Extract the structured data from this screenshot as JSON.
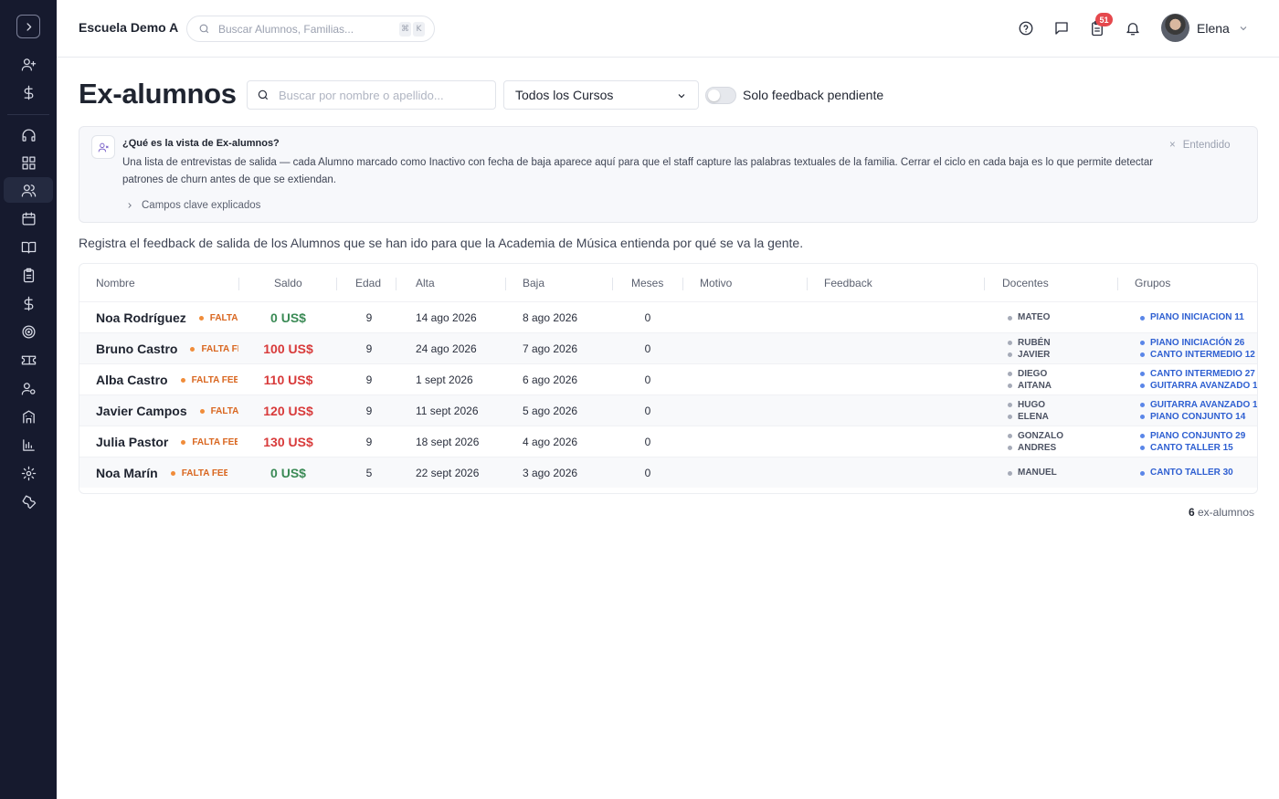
{
  "app": {
    "school_name": "Escuela Demo A",
    "global_search_placeholder": "Buscar Alumnos, Familias...",
    "shortcut_keys": [
      "⌘",
      "K"
    ],
    "notification_count": "51",
    "user_name": "Elena"
  },
  "sidebar": {
    "items": [
      {
        "icon": "user-plus-icon"
      },
      {
        "icon": "dollar-icon"
      },
      {
        "icon": "headset-icon"
      },
      {
        "icon": "dashboard-icon"
      },
      {
        "icon": "users-icon",
        "active": true
      },
      {
        "icon": "calendar-icon"
      },
      {
        "icon": "book-icon"
      },
      {
        "icon": "clipboard-icon"
      },
      {
        "icon": "dollar-icon"
      },
      {
        "icon": "target-icon"
      },
      {
        "icon": "ticket-icon"
      },
      {
        "icon": "user-settings-icon"
      },
      {
        "icon": "building-icon"
      },
      {
        "icon": "chart-icon"
      },
      {
        "icon": "gear-icon"
      },
      {
        "icon": "wrench-icon"
      }
    ]
  },
  "page": {
    "title": "Ex-alumnos",
    "search_placeholder": "Buscar por nombre o apellido...",
    "course_filter": "Todos los Cursos",
    "toggle_label": "Solo feedback pendiente",
    "toggle_on": false
  },
  "info": {
    "title": "¿Qué es la vista de Ex-alumnos?",
    "text": "Una lista de entrevistas de salida — cada Alumno marcado como Inactivo con fecha de baja aparece aquí para que el staff capture las palabras textuales de la familia. Cerrar el ciclo en cada baja es lo que permite detectar patrones de churn antes de que se extiendan.",
    "expander": "Campos clave explicados",
    "dismiss": "Entendido"
  },
  "description": "Registra el feedback de salida de los Alumnos que se han ido para que la Academia de Música entienda por qué se va la gente.",
  "table": {
    "columns": [
      "Nombre",
      "Saldo",
      "Edad",
      "Alta",
      "Baja",
      "Meses",
      "Motivo",
      "Feedback",
      "Docentes",
      "Grupos"
    ],
    "rows": [
      {
        "name": "Noa Rodríguez",
        "badge": "FALTA FEEDBACK",
        "saldo": "0 US$",
        "saldo_positive": true,
        "edad": "9",
        "alta": "14 ago 2026",
        "baja": "8 ago 2026",
        "meses": "0",
        "motivo": "",
        "feedback": "",
        "docentes": [
          "MATEO"
        ],
        "grupos": [
          "PIANO INICIACION 11"
        ]
      },
      {
        "name": "Bruno Castro",
        "badge": "FALTA FEEDBACK",
        "saldo": "100 US$",
        "saldo_positive": false,
        "edad": "9",
        "alta": "24 ago 2026",
        "baja": "7 ago 2026",
        "meses": "0",
        "motivo": "",
        "feedback": "",
        "docentes": [
          "RUBÉN",
          "JAVIER"
        ],
        "grupos": [
          "PIANO INICIACIÓN 26",
          "CANTO INTERMEDIO 12"
        ]
      },
      {
        "name": "Alba Castro",
        "badge": "FALTA FEEDBACK",
        "saldo": "110 US$",
        "saldo_positive": false,
        "edad": "9",
        "alta": "1 sept 2026",
        "baja": "6 ago 2026",
        "meses": "0",
        "motivo": "",
        "feedback": "",
        "docentes": [
          "DIEGO",
          "AITANA"
        ],
        "grupos": [
          "CANTO INTERMEDIO 27",
          "GUITARRA AVANZADO 1"
        ]
      },
      {
        "name": "Javier Campos",
        "badge": "FALTA FEEDBACK",
        "saldo": "120 US$",
        "saldo_positive": false,
        "edad": "9",
        "alta": "11 sept 2026",
        "baja": "5 ago 2026",
        "meses": "0",
        "motivo": "",
        "feedback": "",
        "docentes": [
          "HUGO",
          "ELENA"
        ],
        "grupos": [
          "GUITARRA AVANZADO 1",
          "PIANO CONJUNTO 14"
        ]
      },
      {
        "name": "Julia Pastor",
        "badge": "FALTA FEEDBACK",
        "saldo": "130 US$",
        "saldo_positive": false,
        "edad": "9",
        "alta": "18 sept 2026",
        "baja": "4 ago 2026",
        "meses": "0",
        "motivo": "",
        "feedback": "",
        "docentes": [
          "GONZALO",
          "ANDRES"
        ],
        "grupos": [
          "PIANO CONJUNTO 29",
          "CANTO TALLER 15"
        ]
      },
      {
        "name": "Noa Marín",
        "badge": "FALTA FEEDBACK",
        "saldo": "0 US$",
        "saldo_positive": true,
        "edad": "5",
        "alta": "22 sept 2026",
        "baja": "3 ago 2026",
        "meses": "0",
        "motivo": "",
        "feedback": "",
        "docentes": [
          "MANUEL"
        ],
        "grupos": [
          "CANTO TALLER 30"
        ]
      }
    ]
  },
  "footer": {
    "count": "6",
    "count_label": "ex-alumnos"
  },
  "colors": {
    "sidebar_bg": "#161a2e",
    "badge": "#d9661f",
    "saldo_positive": "#3a8a55",
    "saldo_negative": "#d83a3a",
    "group_chip": "#2e5fd1"
  }
}
